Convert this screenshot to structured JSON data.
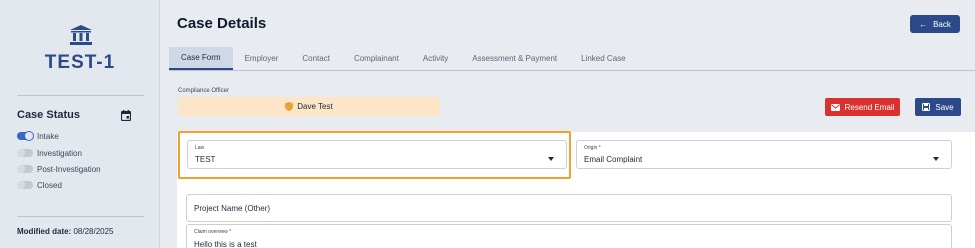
{
  "sidebar": {
    "case_id": "TEST-1",
    "status_title": "Case Status",
    "statuses": [
      {
        "label": "Intake",
        "on": true
      },
      {
        "label": "Investigation",
        "on": false
      },
      {
        "label": "Post-Investigation",
        "on": false
      },
      {
        "label": "Closed",
        "on": false
      }
    ],
    "modified_label": "Modified date:",
    "modified_value": "08/28/2025"
  },
  "header": {
    "title": "Case Details",
    "back_label": "Back"
  },
  "tabs": [
    {
      "label": "Case Form",
      "active": true
    },
    {
      "label": "Employer",
      "active": false
    },
    {
      "label": "Contact",
      "active": false
    },
    {
      "label": "Complainant",
      "active": false
    },
    {
      "label": "Activity",
      "active": false
    },
    {
      "label": "Assessment & Payment",
      "active": false
    },
    {
      "label": "Linked Case",
      "active": false
    }
  ],
  "officer": {
    "label": "Compliance Officer",
    "name": "Dave Test"
  },
  "actions": {
    "resend_label": "Resend Email",
    "save_label": "Save"
  },
  "form": {
    "law": {
      "label": "Law",
      "value": "TEST"
    },
    "origin": {
      "label": "Origin *",
      "value": "Email Complaint"
    },
    "project": {
      "placeholder": "Project Name (Other)"
    },
    "claim": {
      "label": "Claim overview *",
      "value": "Hello this is a test"
    }
  },
  "colors": {
    "primary": "#2c4a8a",
    "danger": "#d93030",
    "officer_bg": "#fde5c8",
    "highlight": "#f0a32b"
  }
}
